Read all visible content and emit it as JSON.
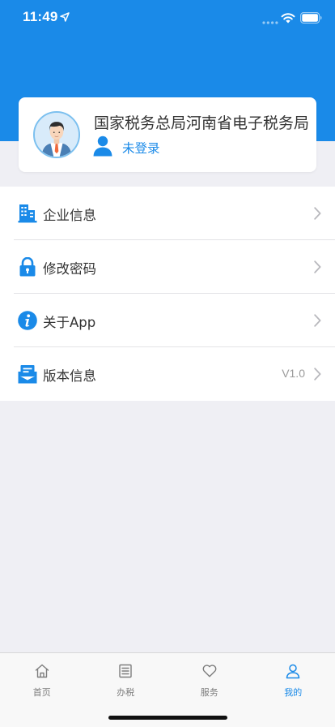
{
  "status_bar": {
    "time": "11:49",
    "icons": [
      "location-arrow-icon",
      "cellular-signal-icon",
      "wifi-icon",
      "battery-icon"
    ]
  },
  "colors": {
    "brand_blue": "#1a8ae8",
    "page_background": "#efeff4",
    "card_background": "#ffffff",
    "text_primary": "#333333",
    "text_secondary": "#9b9b9b"
  },
  "profile": {
    "avatar_icon": "user-avatar-icon",
    "org_name": "国家税务总局河南省电子税务局",
    "user_icon": "person-icon",
    "login_status": "未登录"
  },
  "menu": {
    "items": [
      {
        "icon": "building-icon",
        "label": "企业信息",
        "value": ""
      },
      {
        "icon": "lock-icon",
        "label": "修改密码",
        "value": ""
      },
      {
        "icon": "info-icon",
        "label": "关于App",
        "value": ""
      },
      {
        "icon": "envelope-icon",
        "label": "版本信息",
        "value": "V1.0"
      }
    ]
  },
  "tab_bar": {
    "tabs": [
      {
        "icon": "home-icon",
        "label": "首页",
        "active": false
      },
      {
        "icon": "document-list-icon",
        "label": "办税",
        "active": false
      },
      {
        "icon": "heart-icon",
        "label": "服务",
        "active": false
      },
      {
        "icon": "person-icon",
        "label": "我的",
        "active": true
      }
    ]
  }
}
